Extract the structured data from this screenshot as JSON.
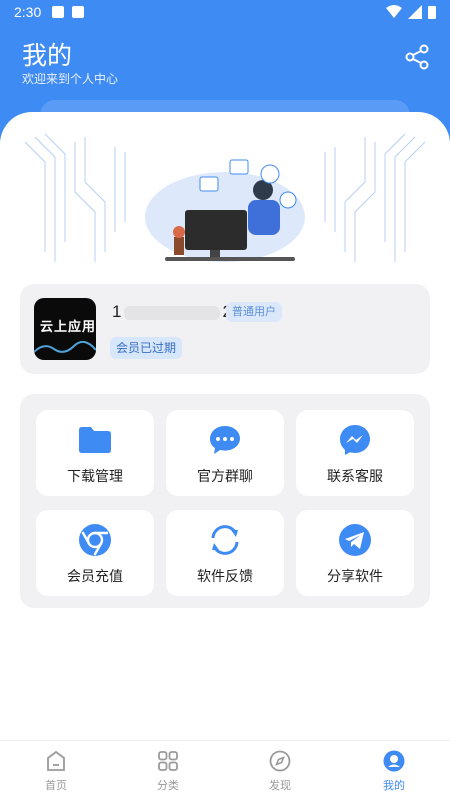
{
  "status_bar": {
    "time": "2:30"
  },
  "header": {
    "title": "我的",
    "subtitle": "欢迎来到个人中心"
  },
  "user": {
    "avatar_text": "云上应用",
    "id_prefix": "1",
    "id_suffix": "2",
    "level_badge": "普通用户",
    "membership_badge": "会员已过期"
  },
  "menu": [
    {
      "label": "下载管理",
      "icon": "folder-icon"
    },
    {
      "label": "官方群聊",
      "icon": "chat-bubble-icon"
    },
    {
      "label": "联系客服",
      "icon": "messenger-icon"
    },
    {
      "label": "会员充值",
      "icon": "chrome-icon"
    },
    {
      "label": "软件反馈",
      "icon": "refresh-icon"
    },
    {
      "label": "分享软件",
      "icon": "telegram-icon"
    }
  ],
  "tabs": [
    {
      "label": "首页",
      "icon": "home-icon"
    },
    {
      "label": "分类",
      "icon": "grid-icon"
    },
    {
      "label": "发现",
      "icon": "compass-icon"
    },
    {
      "label": "我的",
      "icon": "profile-icon"
    }
  ],
  "colors": {
    "primary": "#3f8bf4",
    "card_bg": "#f1f1f3"
  }
}
